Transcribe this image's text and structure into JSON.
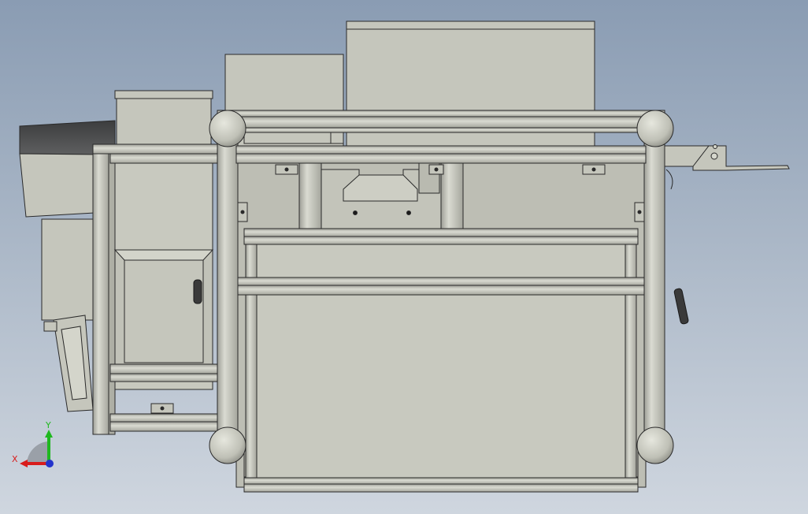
{
  "viewport": {
    "background_top": "#8a9cb3",
    "background_bottom": "#cfd6df",
    "part_fill": "#c5c6bc",
    "part_shade": "#b4b5ab",
    "edge_color": "#2a2a2a",
    "dark_panel": "#4e4f50"
  },
  "triad": {
    "x_label": "X",
    "y_label": "Y",
    "x_color": "#d81c1c",
    "y_color": "#1fb81f",
    "z_color": "#2233cc"
  }
}
